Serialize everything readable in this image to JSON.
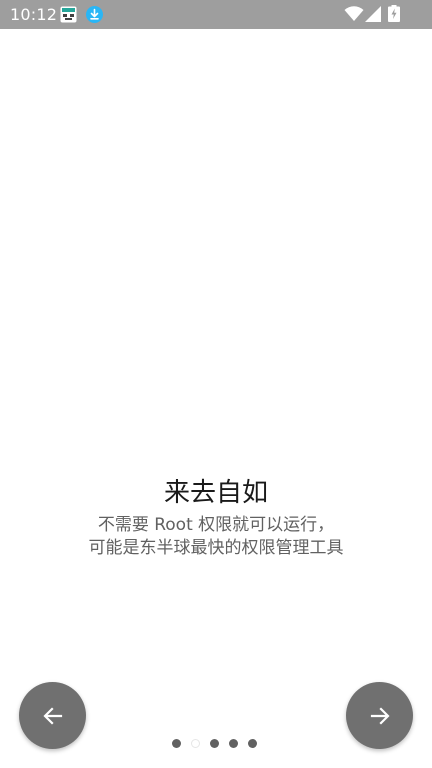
{
  "status_bar": {
    "time": "10:12",
    "notification_icons": [
      "app-notification-icon",
      "download-icon"
    ],
    "system_icons": [
      "wifi-icon",
      "signal-icon",
      "battery-charging-icon"
    ]
  },
  "onboarding": {
    "title": "来去自如",
    "subtitle_line1": "不需要 Root 权限就可以运行，",
    "subtitle_line2": "可能是东半球最快的权限管理工具"
  },
  "navigation": {
    "prev_icon": "arrow-left-icon",
    "next_icon": "arrow-right-icon",
    "page_count": 5,
    "current_page": 2
  },
  "colors": {
    "status_bar": "#9e9e9e",
    "nav_button": "#707070",
    "title_text": "#1a1a1a",
    "subtitle_text": "#616161",
    "download_accent": "#29b6f6"
  }
}
